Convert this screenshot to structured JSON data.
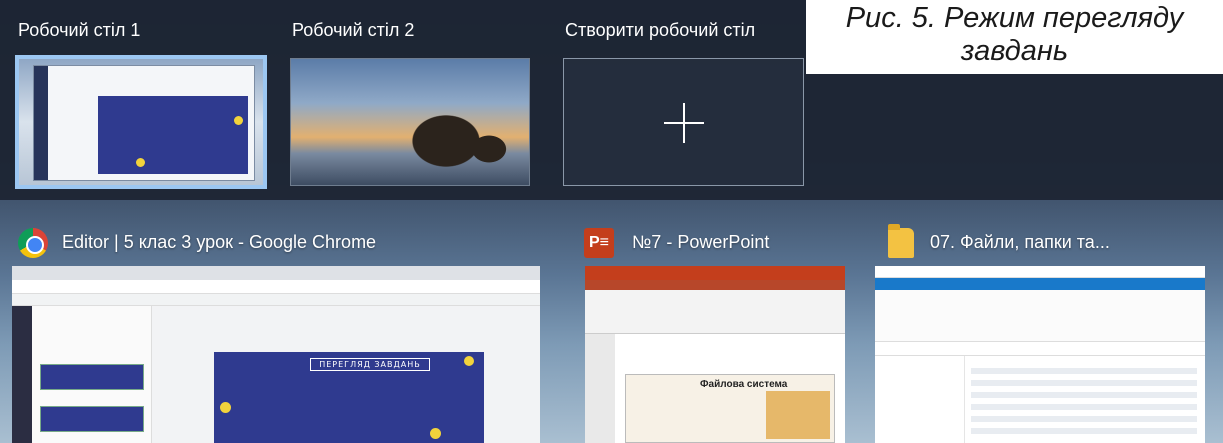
{
  "desktops": [
    {
      "label": "Робочий стіл 1",
      "active": true
    },
    {
      "label": "Робочий стіл 2",
      "active": false
    }
  ],
  "new_desktop": {
    "label": "Створити робочий стіл",
    "icon": "plus-icon"
  },
  "caption": {
    "line1": "Рис. 5. Режим перегляду",
    "line2": "завдань"
  },
  "windows": [
    {
      "title": "Editor | 5 клас 3 урок - Google Chrome",
      "icon": "chrome-icon",
      "slide_banner": "ПЕРЕГЛЯД ЗАВДАНЬ"
    },
    {
      "title": "№7 - PowerPoint",
      "icon": "powerpoint-icon",
      "icon_text": "P≡",
      "slide_title": "Файлова система"
    },
    {
      "title": "07. Файли, папки та...",
      "icon": "folder-icon"
    }
  ],
  "colors": {
    "active_outline": "#9cc7f2",
    "slide_blue": "#2f3a8f",
    "ppt_red": "#c43e1c"
  }
}
